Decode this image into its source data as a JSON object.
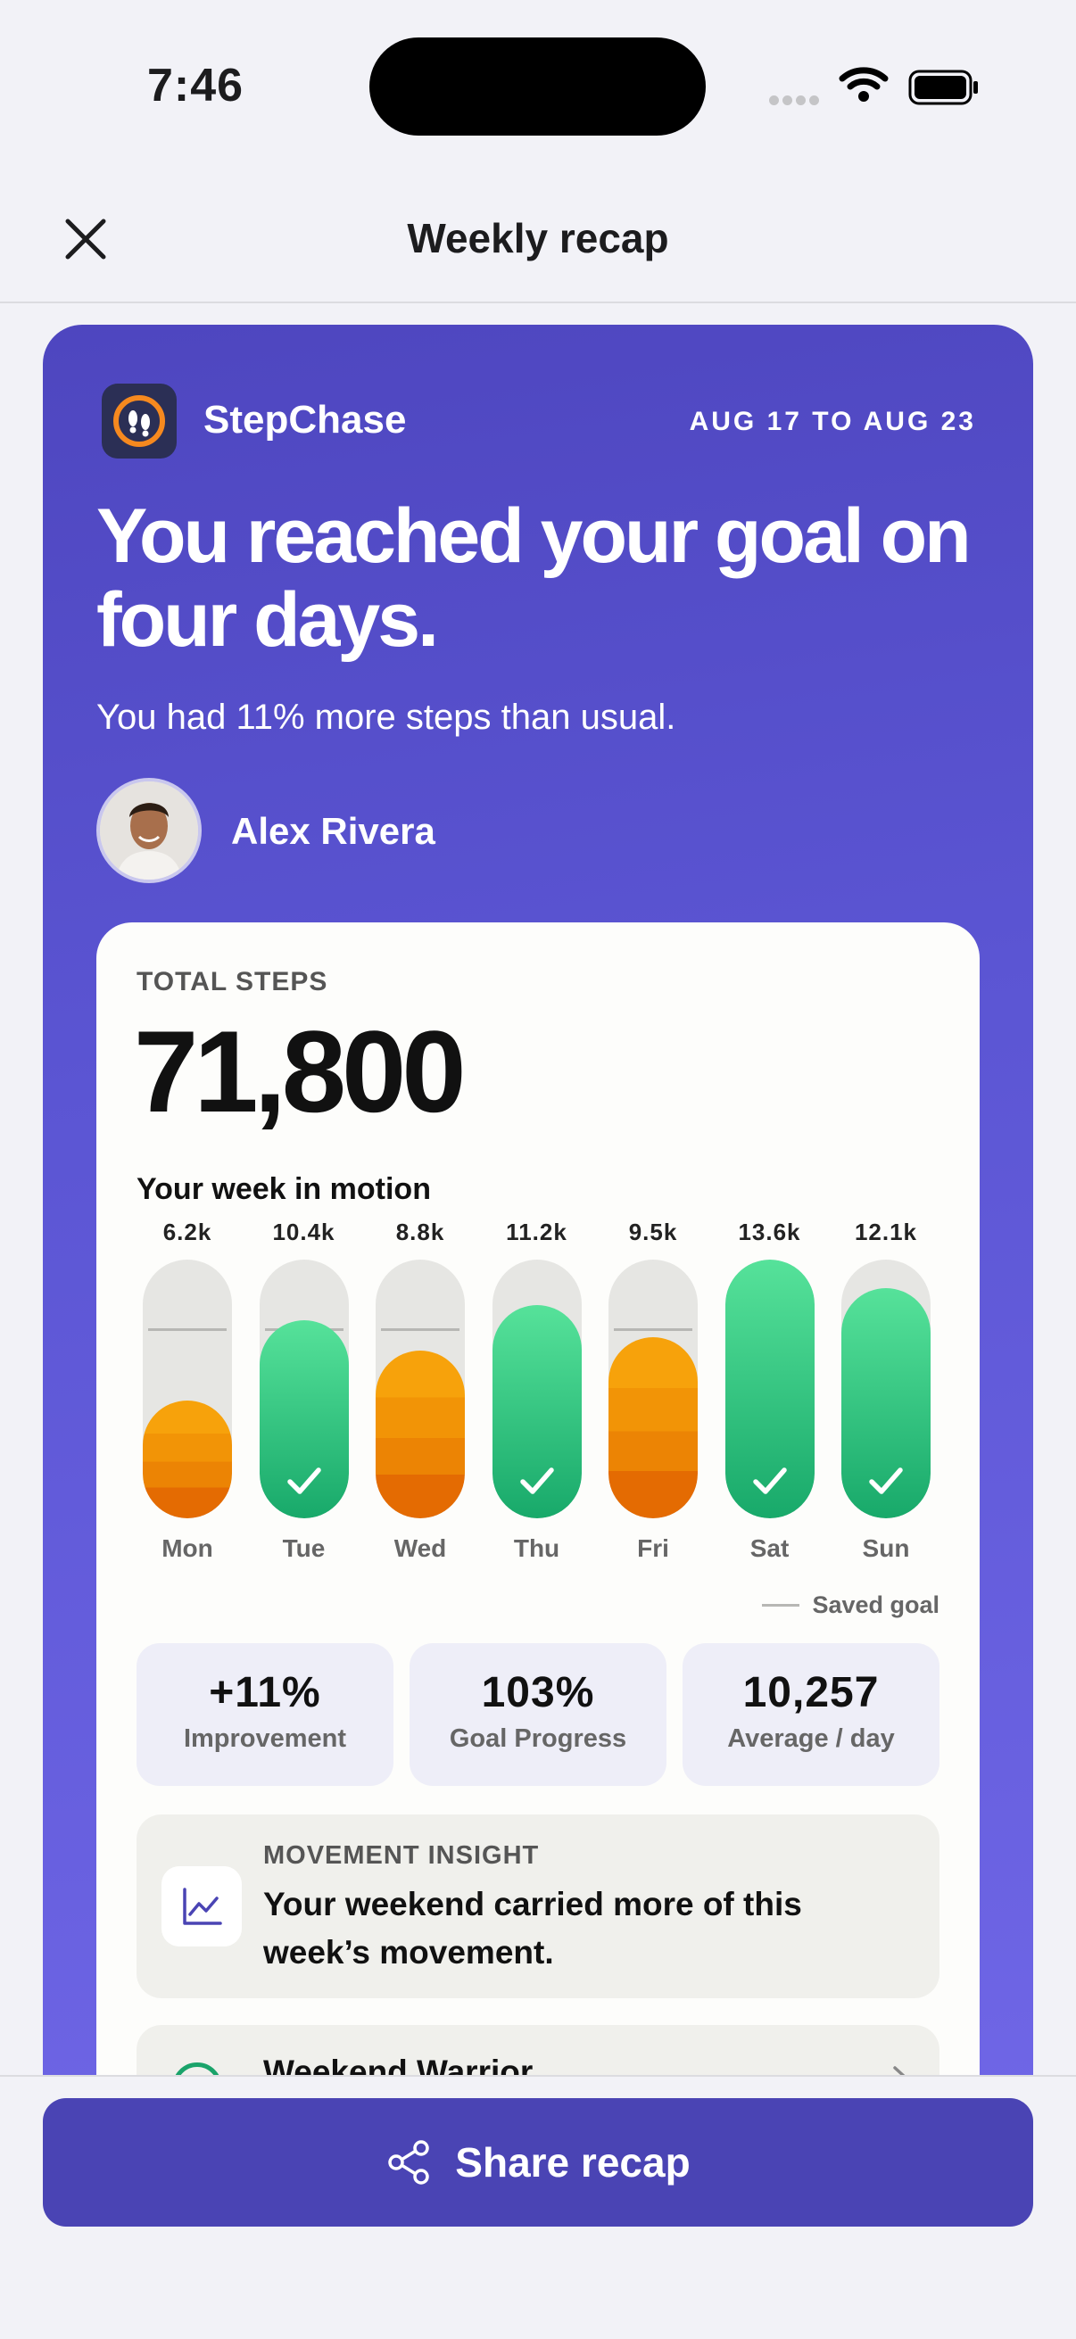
{
  "status": {
    "time": "7:46"
  },
  "nav": {
    "title": "Weekly recap"
  },
  "brand": {
    "name": "StepChase"
  },
  "recap": {
    "date_range": "AUG 17 TO AUG 23",
    "headline": "You reached your goal on four days.",
    "subhead": "You had 11% more steps than usual.",
    "user_name": "Alex Rivera"
  },
  "stats": {
    "total_label": "TOTAL STEPS",
    "total_value": "71,800",
    "week_title": "Your week in motion",
    "legend_label": "Saved goal",
    "goal_steps": 10000
  },
  "chart_data": {
    "type": "bar",
    "categories": [
      "Mon",
      "Tue",
      "Wed",
      "Thu",
      "Fri",
      "Sat",
      "Sun"
    ],
    "value_labels": [
      "6.2k",
      "10.4k",
      "8.8k",
      "11.2k",
      "9.5k",
      "13.6k",
      "12.1k"
    ],
    "values": [
      6200,
      10400,
      8800,
      11200,
      9500,
      13600,
      12100
    ],
    "goal": 10000,
    "ylim": [
      0,
      13600
    ],
    "colors": {
      "met": "#1fb574",
      "missed": "#f29406"
    }
  },
  "metrics": [
    {
      "value": "+11%",
      "label": "Improvement"
    },
    {
      "value": "103%",
      "label": "Goal Progress"
    },
    {
      "value": "10,257",
      "label": "Average / day"
    }
  ],
  "insight": {
    "kicker": "MOVEMENT INSIGHT",
    "text": "Your weekend carried more of this week’s movement.",
    "icon": "line-chart-icon"
  },
  "badge": {
    "title": "Weekend Warrior",
    "icon": "badge-ring-icon"
  },
  "share": {
    "label": "Share recap",
    "icon": "share-icon"
  },
  "colors": {
    "accent": "#4a44b4",
    "card_top": "#4e46bf",
    "card_bottom": "#6f66e6"
  }
}
